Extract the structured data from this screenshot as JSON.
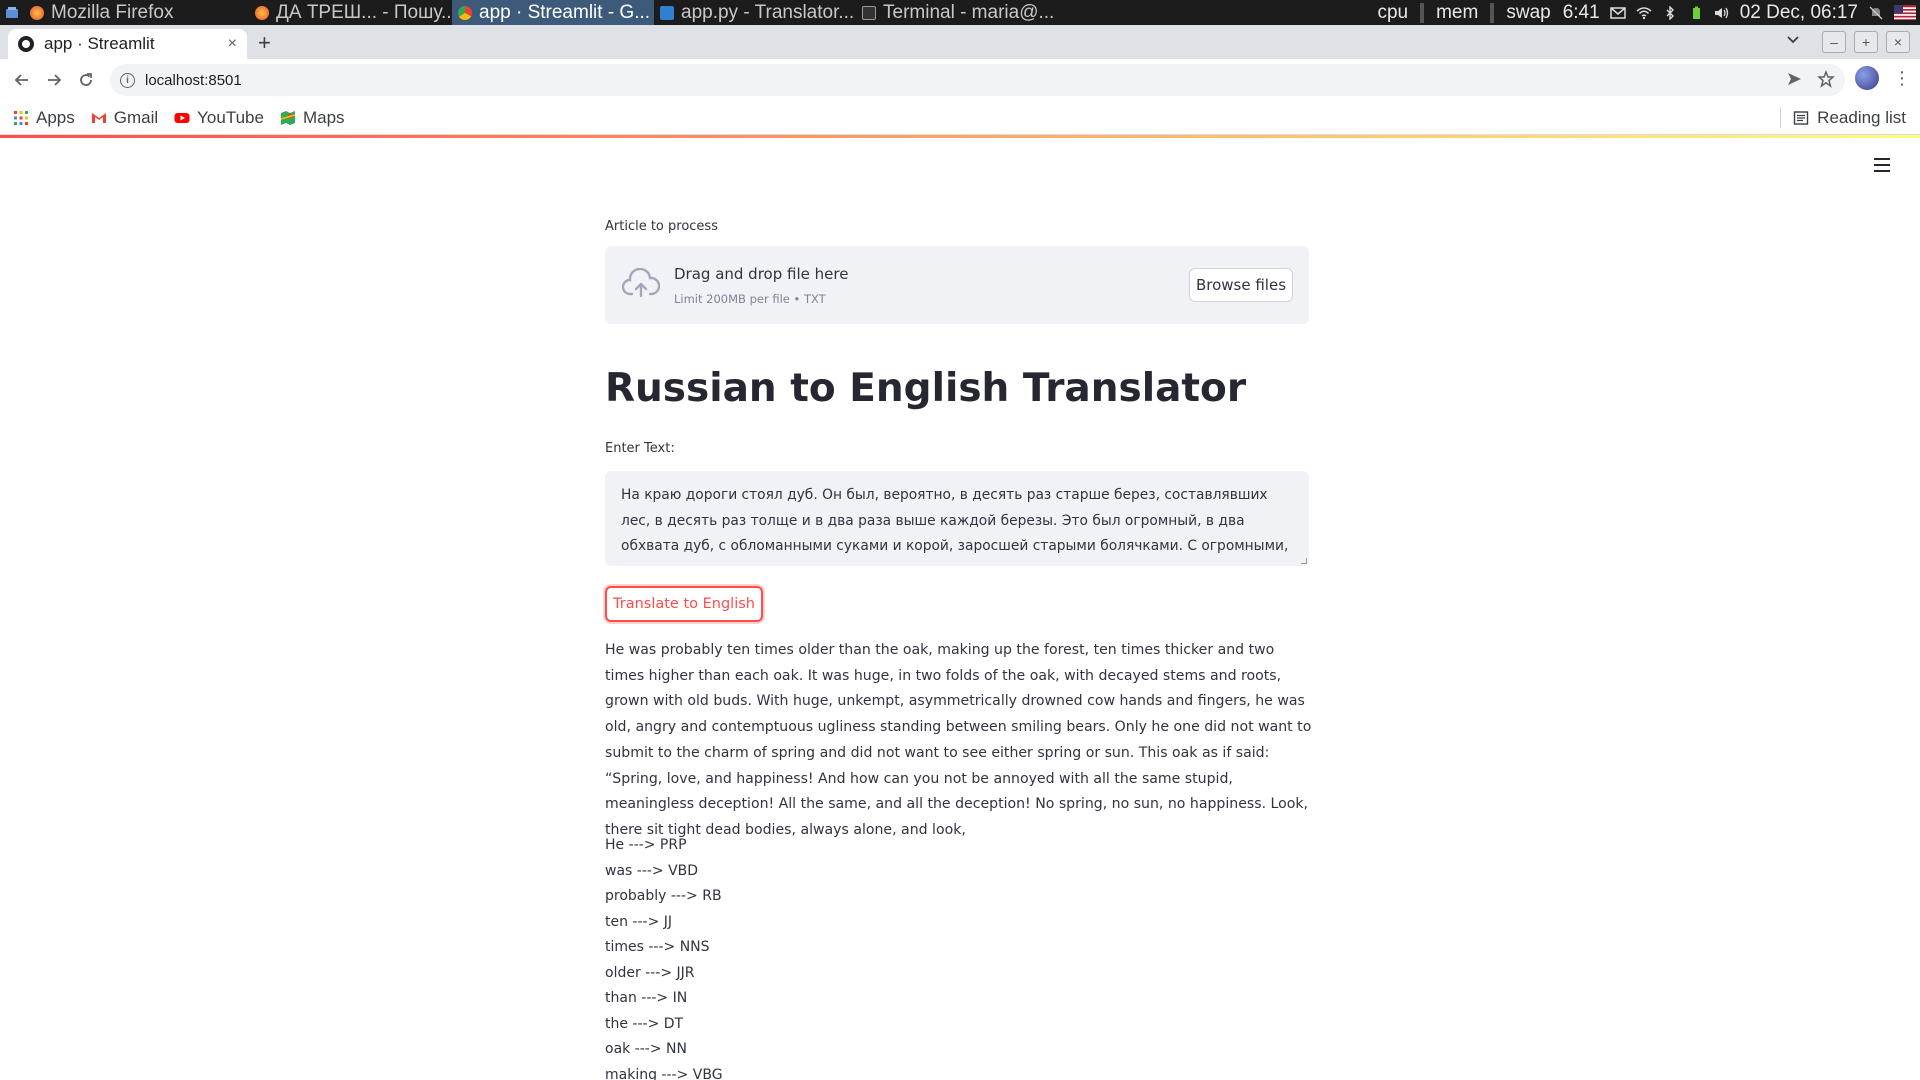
{
  "taskbar": {
    "tasks": [
      {
        "label": "Mozilla Firefox",
        "active": false
      },
      {
        "label": "ДА ТРЕШ... - Пошу...",
        "active": false
      },
      {
        "label": "app · Streamlit - G...",
        "active": true
      },
      {
        "label": "app.py - Translator...",
        "active": false
      },
      {
        "label": "Terminal - maria@...",
        "active": false
      }
    ],
    "monitors": [
      "cpu",
      "mem",
      "swap"
    ],
    "time_short": "6:41",
    "datetime": "02 Dec, 06:17"
  },
  "browser": {
    "tab_title": "app · Streamlit",
    "tab_close": "×",
    "new_tab": "+",
    "url": "localhost:8501",
    "bookmarks": [
      "Apps",
      "Gmail",
      "YouTube",
      "Maps"
    ],
    "reading_list": "Reading list"
  },
  "app": {
    "uploader": {
      "label": "Article to process",
      "drop_text": "Drag and drop file here",
      "limit_text": "Limit 200MB per file • TXT",
      "browse_label": "Browse files"
    },
    "title": "Russian to English Translator",
    "input_label": "Enter Text:",
    "input_value": "На краю дороги стоял дуб. Он был, вероятно, в десять раз старше берез, составлявших лес, в десять раз толще и в два раза выше каждой березы. Это был огромный, в два обхвата дуб, с обломанными суками и корой, заросшей старыми болячками. С огромными, неуклюже,",
    "translate_label": "Translate to English",
    "output_text": "He was probably ten times older than the oak, making up the forest, ten times thicker and two times higher than each oak. It was huge, in two folds of the oak, with decayed stems and roots, grown with old buds. With huge, unkempt, asymmetrically drowned cow hands and fingers, he was old, angry and contemptuous ugliness standing between smiling bears. Only he one did not want to submit to the charm of spring and did not want to see either spring or sun. This oak as if said: “Spring, love, and happiness! And how can you not be annoyed with all the same stupid, meaningless deception! All the same, and all the deception! No spring, no sun, no happiness. Look, there sit tight dead bodies, always alone, and look,",
    "pos_tags": [
      "He ---> PRP",
      "was ---> VBD",
      "probably ---> RB",
      "ten ---> JJ",
      "times ---> NNS",
      "older ---> JJR",
      "than ---> IN",
      "the ---> DT",
      "oak ---> NN",
      "making ---> VBG"
    ]
  },
  "colors": {
    "accent": "#ff4b4b",
    "text": "#31333f",
    "widget_bg": "#f0f2f6"
  }
}
